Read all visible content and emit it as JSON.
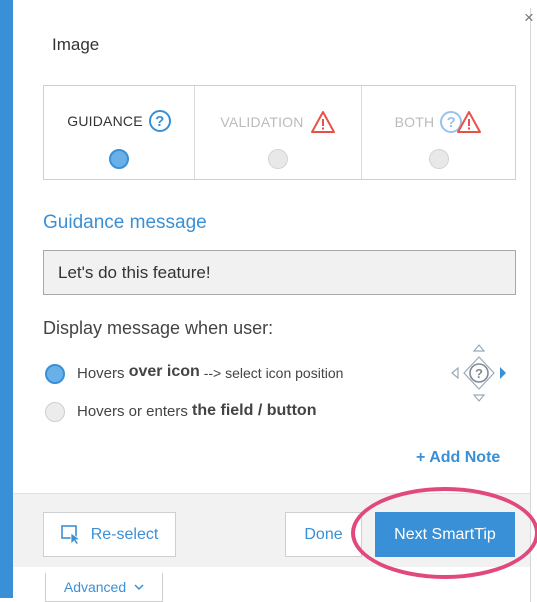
{
  "window": {
    "title": "Image",
    "close_label": "×"
  },
  "modes": [
    {
      "label": "GUIDANCE",
      "selected": true
    },
    {
      "label": "VALIDATION",
      "selected": false
    },
    {
      "label": "BOTH",
      "selected": false
    }
  ],
  "guidance": {
    "heading": "Guidance message",
    "message_value": "Let's do this feature!"
  },
  "display": {
    "label": "Display message when user:",
    "options": [
      {
        "text_a": "Hovers ",
        "text_b": "over icon",
        "text_c": " --> select icon position",
        "selected": true
      },
      {
        "text_a": "Hovers or enters ",
        "text_b": "the field / button",
        "selected": false
      }
    ]
  },
  "add_note_label": "+ Add Note",
  "footer": {
    "reselect_label": "Re-select",
    "done_label": "Done",
    "next_label": "Next SmartTip"
  },
  "advanced_label": "Advanced",
  "colors": {
    "accent": "#3a90d6",
    "warning": "#e8514a",
    "highlight": "#e0487e"
  },
  "icons": [
    "question-icon",
    "warning-icon",
    "position-picker-icon",
    "reselect-cursor-icon",
    "chevron-down-icon",
    "close-icon"
  ]
}
